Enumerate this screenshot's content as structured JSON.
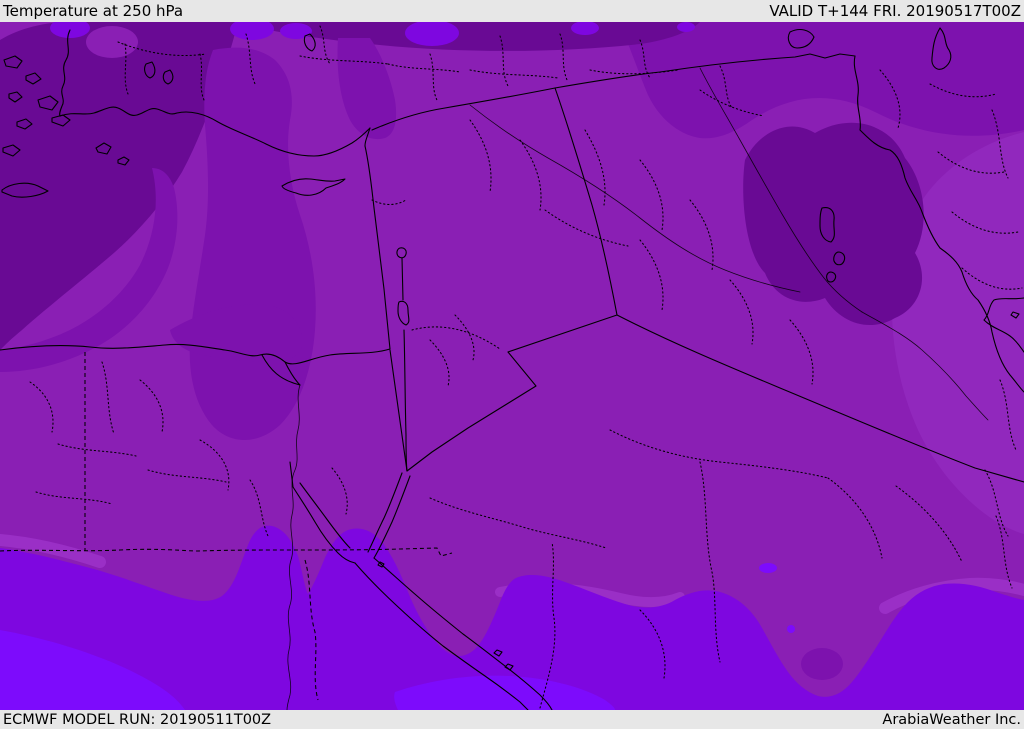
{
  "header": {
    "title": "Temperature at 250 hPa",
    "valid": "VALID T+144 FRI. 20190517T00Z"
  },
  "footer": {
    "model_run": "ECMWF MODEL RUN: 20190511T00Z",
    "brand": "ArabiaWeather Inc."
  },
  "map": {
    "colors": {
      "bar_bg": "#e7e7e7",
      "bar_text": "#000000",
      "line": "#000000",
      "band_mid": "#8a1fb4",
      "band_dark": "#7d12ae",
      "band_deep": "#690a94",
      "band_light_east": "#9128bd",
      "band_light_rim": "#9a2fc6",
      "band_violet": "#7e07e0",
      "band_bright": "#7d0bfc"
    }
  }
}
